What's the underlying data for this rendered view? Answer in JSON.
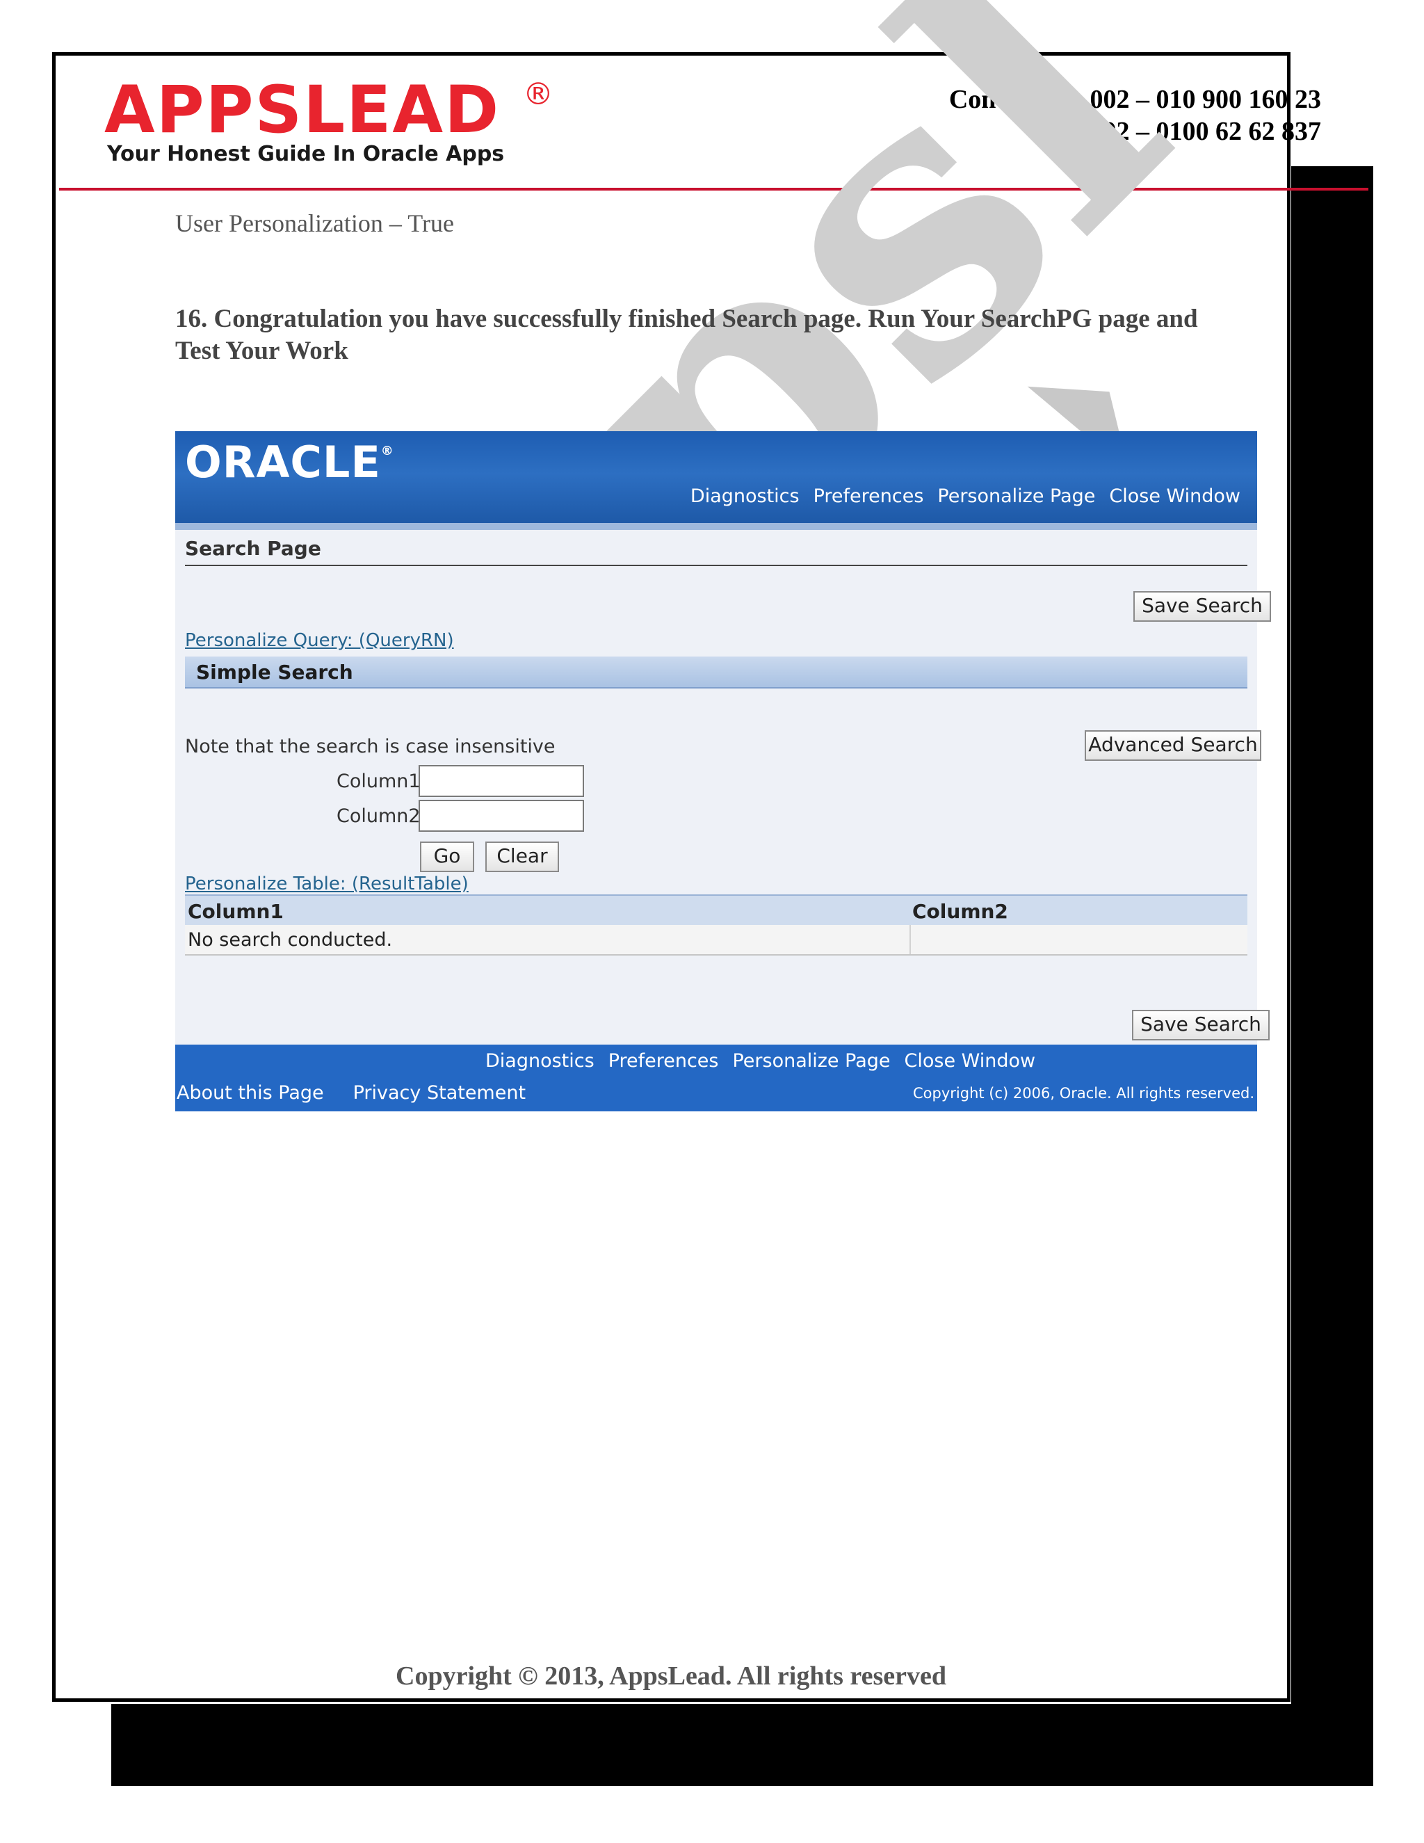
{
  "header": {
    "logo_text": "APPSLEAD",
    "logo_reg": "®",
    "tagline": "Your Honest Guide In Oracle Apps",
    "contact_line1": "Contact Us: 002 – 010 900 160 23",
    "contact_line2": "002 – 0100 62 62 837"
  },
  "watermark": "appsl",
  "content": {
    "subtitle": "User Personalization – True",
    "step_text": "16. Congratulation you have successfully finished Search page. Run Your SearchPG page and Test Your Work"
  },
  "screenshot": {
    "brand": "ORACLE",
    "global_links": [
      "Diagnostics",
      "Preferences",
      "Personalize Page",
      "Close Window"
    ],
    "page_title": "Search Page",
    "save_search_label": "Save Search",
    "personalize_query_link": "Personalize Query: (QueryRN)",
    "region_title": "Simple Search",
    "note": "Note that the search is case insensitive",
    "advanced_search_label": "Advanced Search",
    "fields": [
      {
        "label": "Column1",
        "value": ""
      },
      {
        "label": "Column2",
        "value": ""
      }
    ],
    "go_label": "Go",
    "clear_label": "Clear",
    "personalize_table_link": "Personalize Table: (ResultTable)",
    "table": {
      "columns": [
        "Column1",
        "Column2"
      ],
      "empty_message": "No search conducted."
    },
    "footer": {
      "links": [
        "Diagnostics",
        "Preferences",
        "Personalize Page",
        "Close Window"
      ],
      "about": "About this Page",
      "privacy": "Privacy Statement",
      "copyright": "Copyright (c) 2006, Oracle. All rights reserved."
    }
  },
  "page_footer": "Copyright © 2013, AppsLead. All rights reserved",
  "colors": {
    "brand_red": "#e8242e",
    "oracle_blue": "#2468c4",
    "link_blue": "#25648f"
  }
}
